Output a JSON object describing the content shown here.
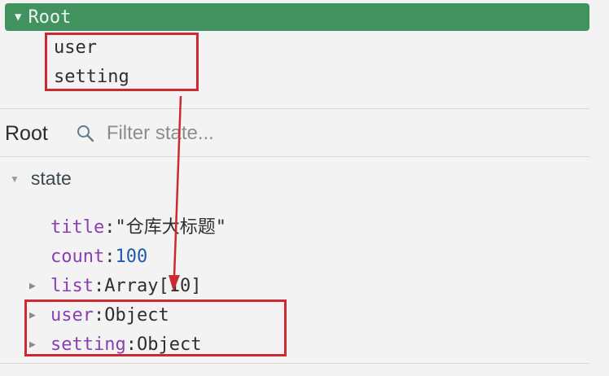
{
  "module_tree": {
    "root_label": "Root",
    "children": [
      "user",
      "setting"
    ]
  },
  "state_panel": {
    "title": "Root",
    "filter": {
      "placeholder": "Filter state..."
    },
    "section_label": "state",
    "props": [
      {
        "key": "title",
        "value": "\"仓库大标题\"",
        "type": "string",
        "expandable": false
      },
      {
        "key": "count",
        "value": "100",
        "type": "number",
        "expandable": false
      },
      {
        "key": "list",
        "value": "Array[10]",
        "type": "object",
        "expandable": true
      },
      {
        "key": "user",
        "value": "Object",
        "type": "object",
        "expandable": true
      },
      {
        "key": "setting",
        "value": "Object",
        "type": "object",
        "expandable": true
      }
    ]
  },
  "colors": {
    "root_bar": "#41925e",
    "key": "#8a3fb3",
    "number": "#1f5aa8",
    "annotation": "#cc2a33"
  },
  "icons": {
    "expanded": "triangle-down-icon",
    "collapsed": "triangle-right-icon",
    "search": "search-icon"
  }
}
